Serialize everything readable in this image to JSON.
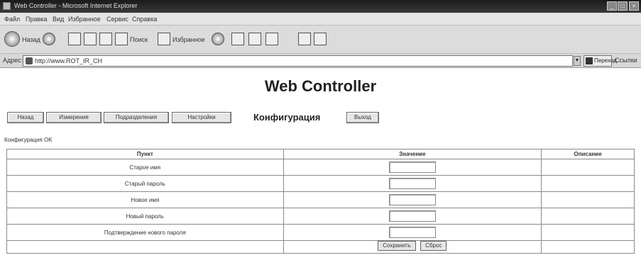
{
  "window": {
    "title": "Web Controller - Microsoft Internet Explorer",
    "buttons": [
      "_",
      "□",
      "×"
    ]
  },
  "menu": [
    "Файл",
    "Правка",
    "Вид",
    "Избранное",
    "Сервис",
    "Справка"
  ],
  "toolbar": {
    "back_label": "Назад",
    "search_label": "Поиск",
    "favorites_label": "Избранное"
  },
  "address": {
    "label": "Адрес:",
    "url": "http://www.ROT_IR_CH",
    "go_label": "Переход",
    "links_label": "Ссылки"
  },
  "page": {
    "title": "Web Controller",
    "nav_buttons": [
      "Назад",
      "Измерения",
      "Подразделения",
      "Настройки"
    ],
    "section_heading": "Конфигурация",
    "exit_button": "Выход",
    "status_line": "Конфигурация OK",
    "table": {
      "headers": [
        "Пункт",
        "Значение",
        "Описание"
      ],
      "rows": [
        {
          "label": "Старое имя",
          "value": ""
        },
        {
          "label": "Старый пароль",
          "value": ""
        },
        {
          "label": "Новое имя",
          "value": ""
        },
        {
          "label": "Новый пароль",
          "value": ""
        },
        {
          "label": "Подтверждение нового пароля",
          "value": ""
        }
      ],
      "save_button": "Сохранить",
      "reset_button": "Сброс"
    }
  },
  "colors": {
    "titlebar": "#1a1a1a",
    "toolbar": "#dcdcdc",
    "page_bg": "#ffffff"
  }
}
